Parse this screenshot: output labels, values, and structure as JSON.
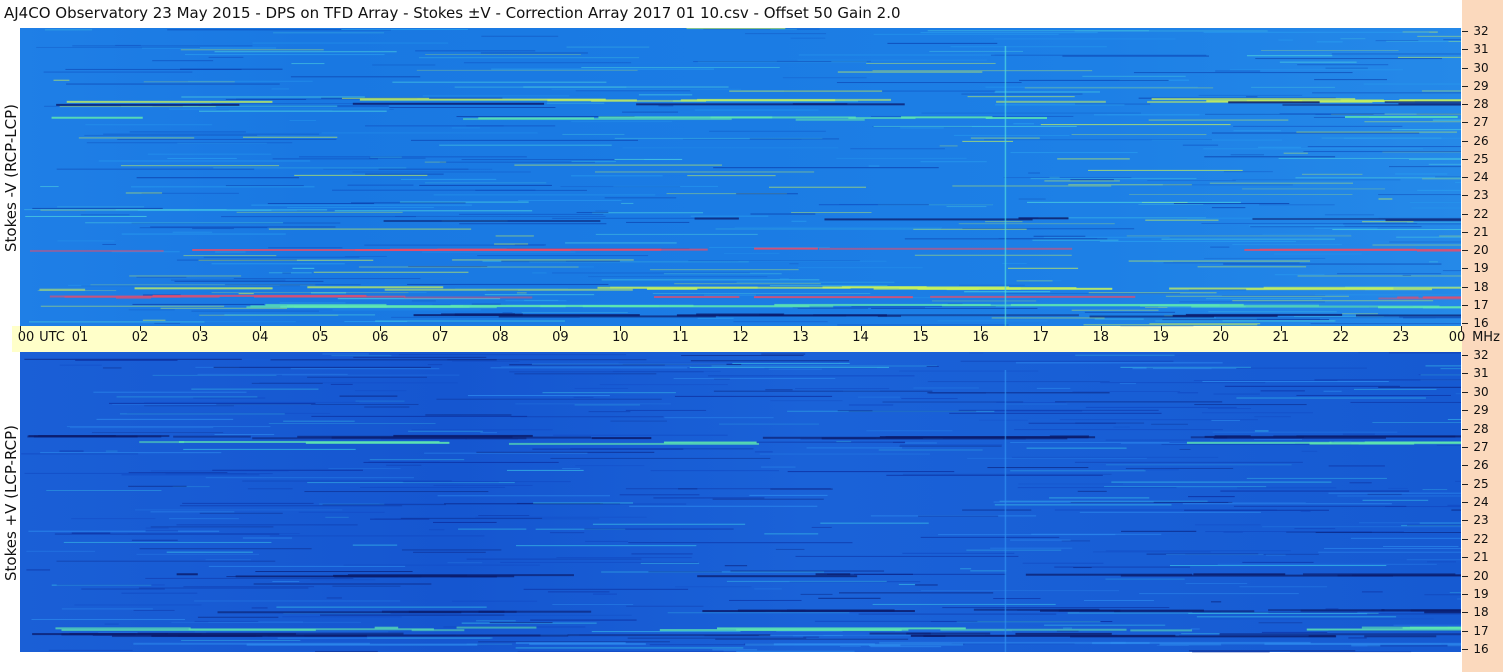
{
  "title": "AJ4CO Observatory  23 May 2015  -  DPS on TFD Array  -  Stokes ±V  -  Correction Array 2017 01 10.csv  -  Offset 50  Gain 2.0",
  "colors": {
    "background": "#ffffff",
    "time_axis_band": "#ffffc9",
    "freq_axis_strip": "#fbd9bd",
    "spectrogram_base_top": "#1f7fe6",
    "spectrogram_base_bottom": "#165ad2",
    "noise_dark": "#0b1d6e",
    "noise_bright": "#5fe8b0",
    "noise_yellow": "#c9f25a",
    "noise_red": "#e84c6a"
  },
  "chart_data": [
    {
      "type": "heatmap",
      "ylabel": "Stokes -V (RCP-LCP)",
      "x_axis": {
        "unit": "UTC",
        "ticks": [
          "00",
          "01",
          "02",
          "03",
          "04",
          "05",
          "06",
          "07",
          "08",
          "09",
          "10",
          "11",
          "12",
          "13",
          "14",
          "15",
          "16",
          "17",
          "18",
          "19",
          "20",
          "21",
          "22",
          "23",
          "00"
        ],
        "range_hours": [
          0,
          24
        ]
      },
      "y_axis": {
        "unit": "MHz",
        "ticks": [
          "16",
          "17",
          "18",
          "19",
          "20",
          "21",
          "22",
          "23",
          "24",
          "25",
          "26",
          "27",
          "28",
          "29",
          "30",
          "31",
          "32"
        ],
        "range_mhz": [
          16,
          32
        ]
      },
      "grid": false
    },
    {
      "type": "heatmap",
      "ylabel": "Stokes +V (LCP-RCP)",
      "x_axis": {
        "unit": "UTC",
        "ticks": [
          "00",
          "01",
          "02",
          "03",
          "04",
          "05",
          "06",
          "07",
          "08",
          "09",
          "10",
          "11",
          "12",
          "13",
          "14",
          "15",
          "16",
          "17",
          "18",
          "19",
          "20",
          "21",
          "22",
          "23",
          "00"
        ],
        "range_hours": [
          0,
          24
        ]
      },
      "y_axis": {
        "unit": "MHz",
        "ticks": [
          "16",
          "17",
          "18",
          "19",
          "20",
          "21",
          "22",
          "23",
          "24",
          "25",
          "26",
          "27",
          "28",
          "29",
          "30",
          "31",
          "32"
        ],
        "range_mhz": [
          16,
          32
        ]
      },
      "grid": false
    }
  ],
  "x_axis_labels": {
    "utc": "UTC",
    "mhz": "MHz"
  }
}
